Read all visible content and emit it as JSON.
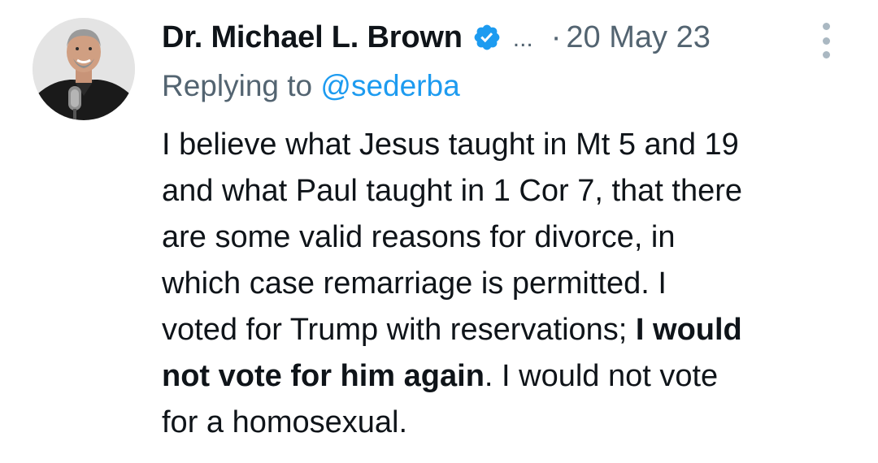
{
  "author": {
    "name": "Dr. Michael L. Brown",
    "verified": true,
    "overflow": "...",
    "date_separator": "·",
    "date": "20 May 23",
    "avatar": "profile-photo"
  },
  "reply": {
    "prefix": "Replying to",
    "handle": "@sederba"
  },
  "tweet": {
    "lines": [
      [
        "I believe what Jesus taught in Mt 5 and 19"
      ],
      [
        "and what Paul taught in 1 Cor 7, that there"
      ],
      [
        "are some valid reasons for divorce, in"
      ],
      [
        "which case remarriage is permitted. I"
      ],
      [
        "voted for Trump with reservations; ",
        "I would"
      ],
      [
        "not vote for him again",
        ". I would not vote"
      ],
      [
        "for a homosexual."
      ]
    ]
  },
  "colors": {
    "verified_badge": "#1d9bf0",
    "link": "#1d9bf0",
    "muted_text": "#536471",
    "text": "#0f1419"
  },
  "icons": {
    "verified": "verified-badge-icon",
    "more": "more-options-icon"
  }
}
